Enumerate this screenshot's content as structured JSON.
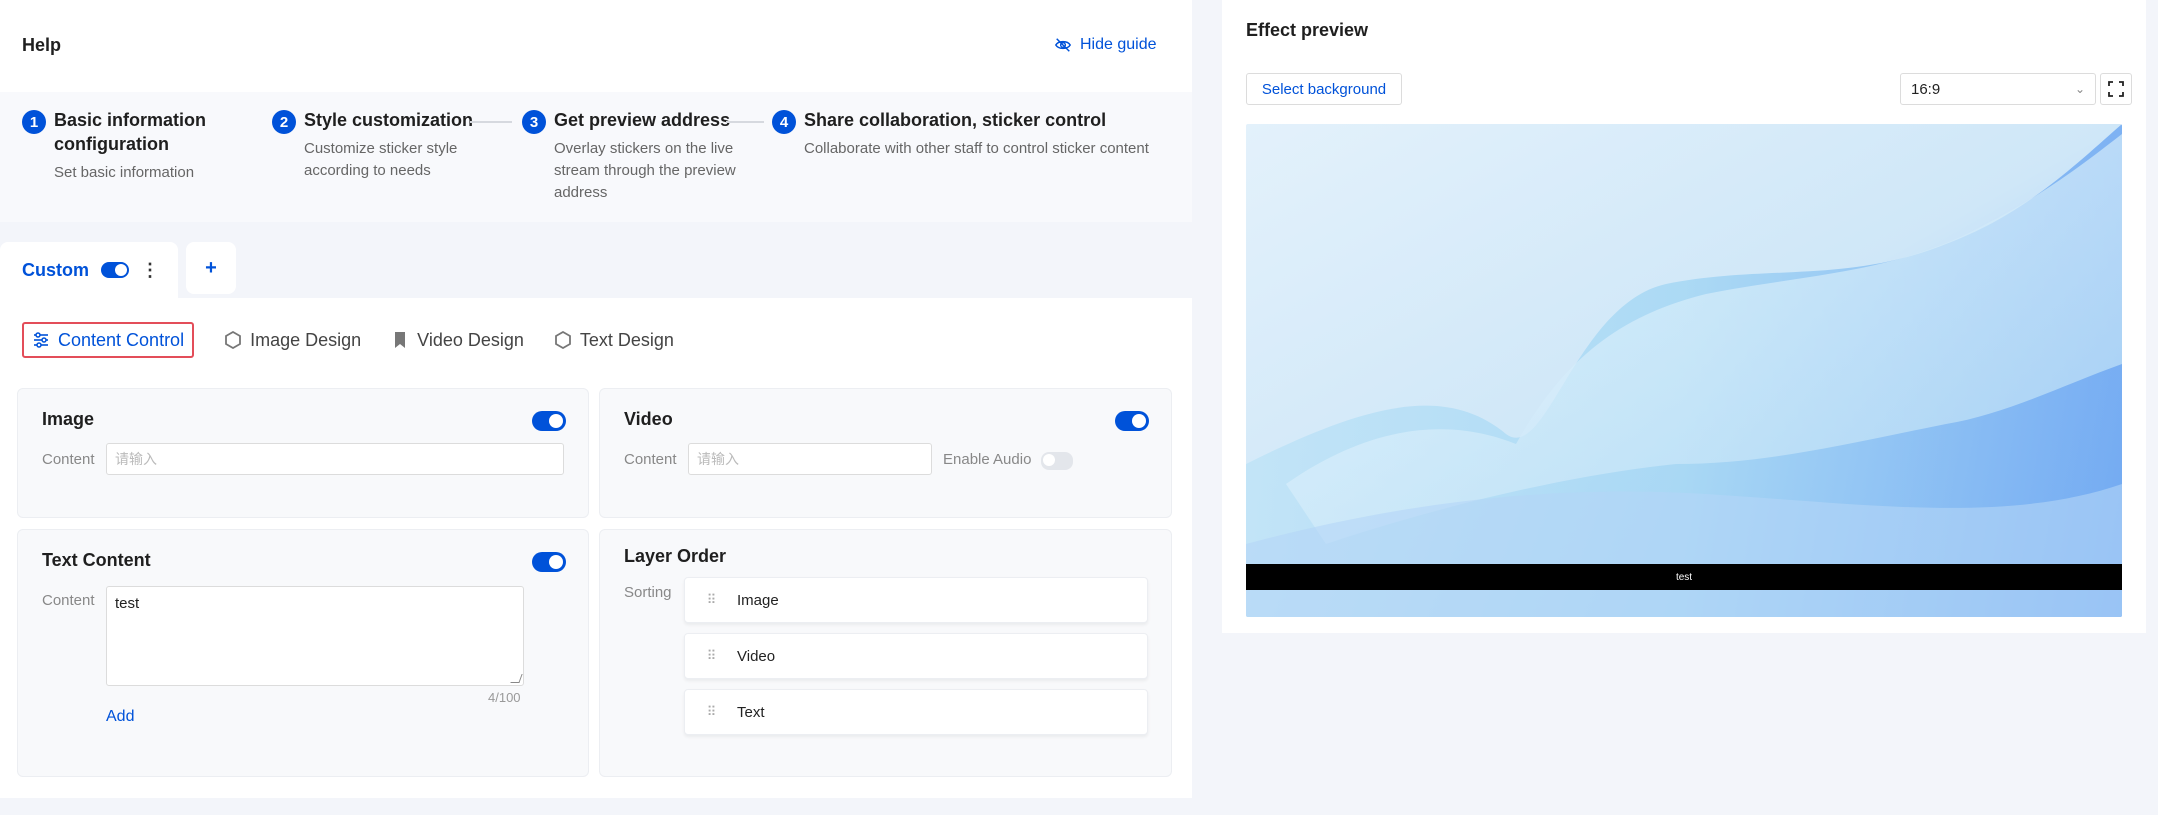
{
  "help": {
    "title": "Help",
    "hide_guide": "Hide guide",
    "steps": [
      {
        "num": "1",
        "title_line1": "Basic information",
        "title_line2": "configuration",
        "desc_line1": "Set basic information"
      },
      {
        "num": "2",
        "title_line1": "Style customization",
        "desc_line1": "Customize sticker style",
        "desc_line2": "according to needs"
      },
      {
        "num": "3",
        "title_line1": "Get preview address",
        "desc_line1": "Overlay stickers on the live",
        "desc_line2": "stream through the preview",
        "desc_line3": "address"
      },
      {
        "num": "4",
        "title_line1": "Share collaboration, sticker control",
        "desc_line1": "Collaborate with other staff to control sticker content"
      }
    ]
  },
  "tabs": {
    "custom_label": "Custom",
    "kebab": "⋮",
    "add": "+"
  },
  "subtabs": [
    {
      "label": "Content Control"
    },
    {
      "label": "Image Design"
    },
    {
      "label": "Video Design"
    },
    {
      "label": "Text Design"
    }
  ],
  "panels": {
    "image": {
      "title": "Image",
      "content_label": "Content",
      "placeholder": "请输入"
    },
    "video": {
      "title": "Video",
      "content_label": "Content",
      "placeholder": "请输入",
      "enable_audio": "Enable Audio"
    },
    "text": {
      "title": "Text Content",
      "content_label": "Content",
      "value": "test",
      "counter": "4/100",
      "add": "Add"
    },
    "layer": {
      "title": "Layer Order",
      "sorting_label": "Sorting",
      "items": [
        "Image",
        "Video",
        "Text"
      ]
    }
  },
  "preview": {
    "title": "Effect preview",
    "select_background": "Select background",
    "ratio": "16:9",
    "caption": "test"
  },
  "colors": {
    "accent": "#0052d9",
    "highlight_border": "#e34d59"
  }
}
